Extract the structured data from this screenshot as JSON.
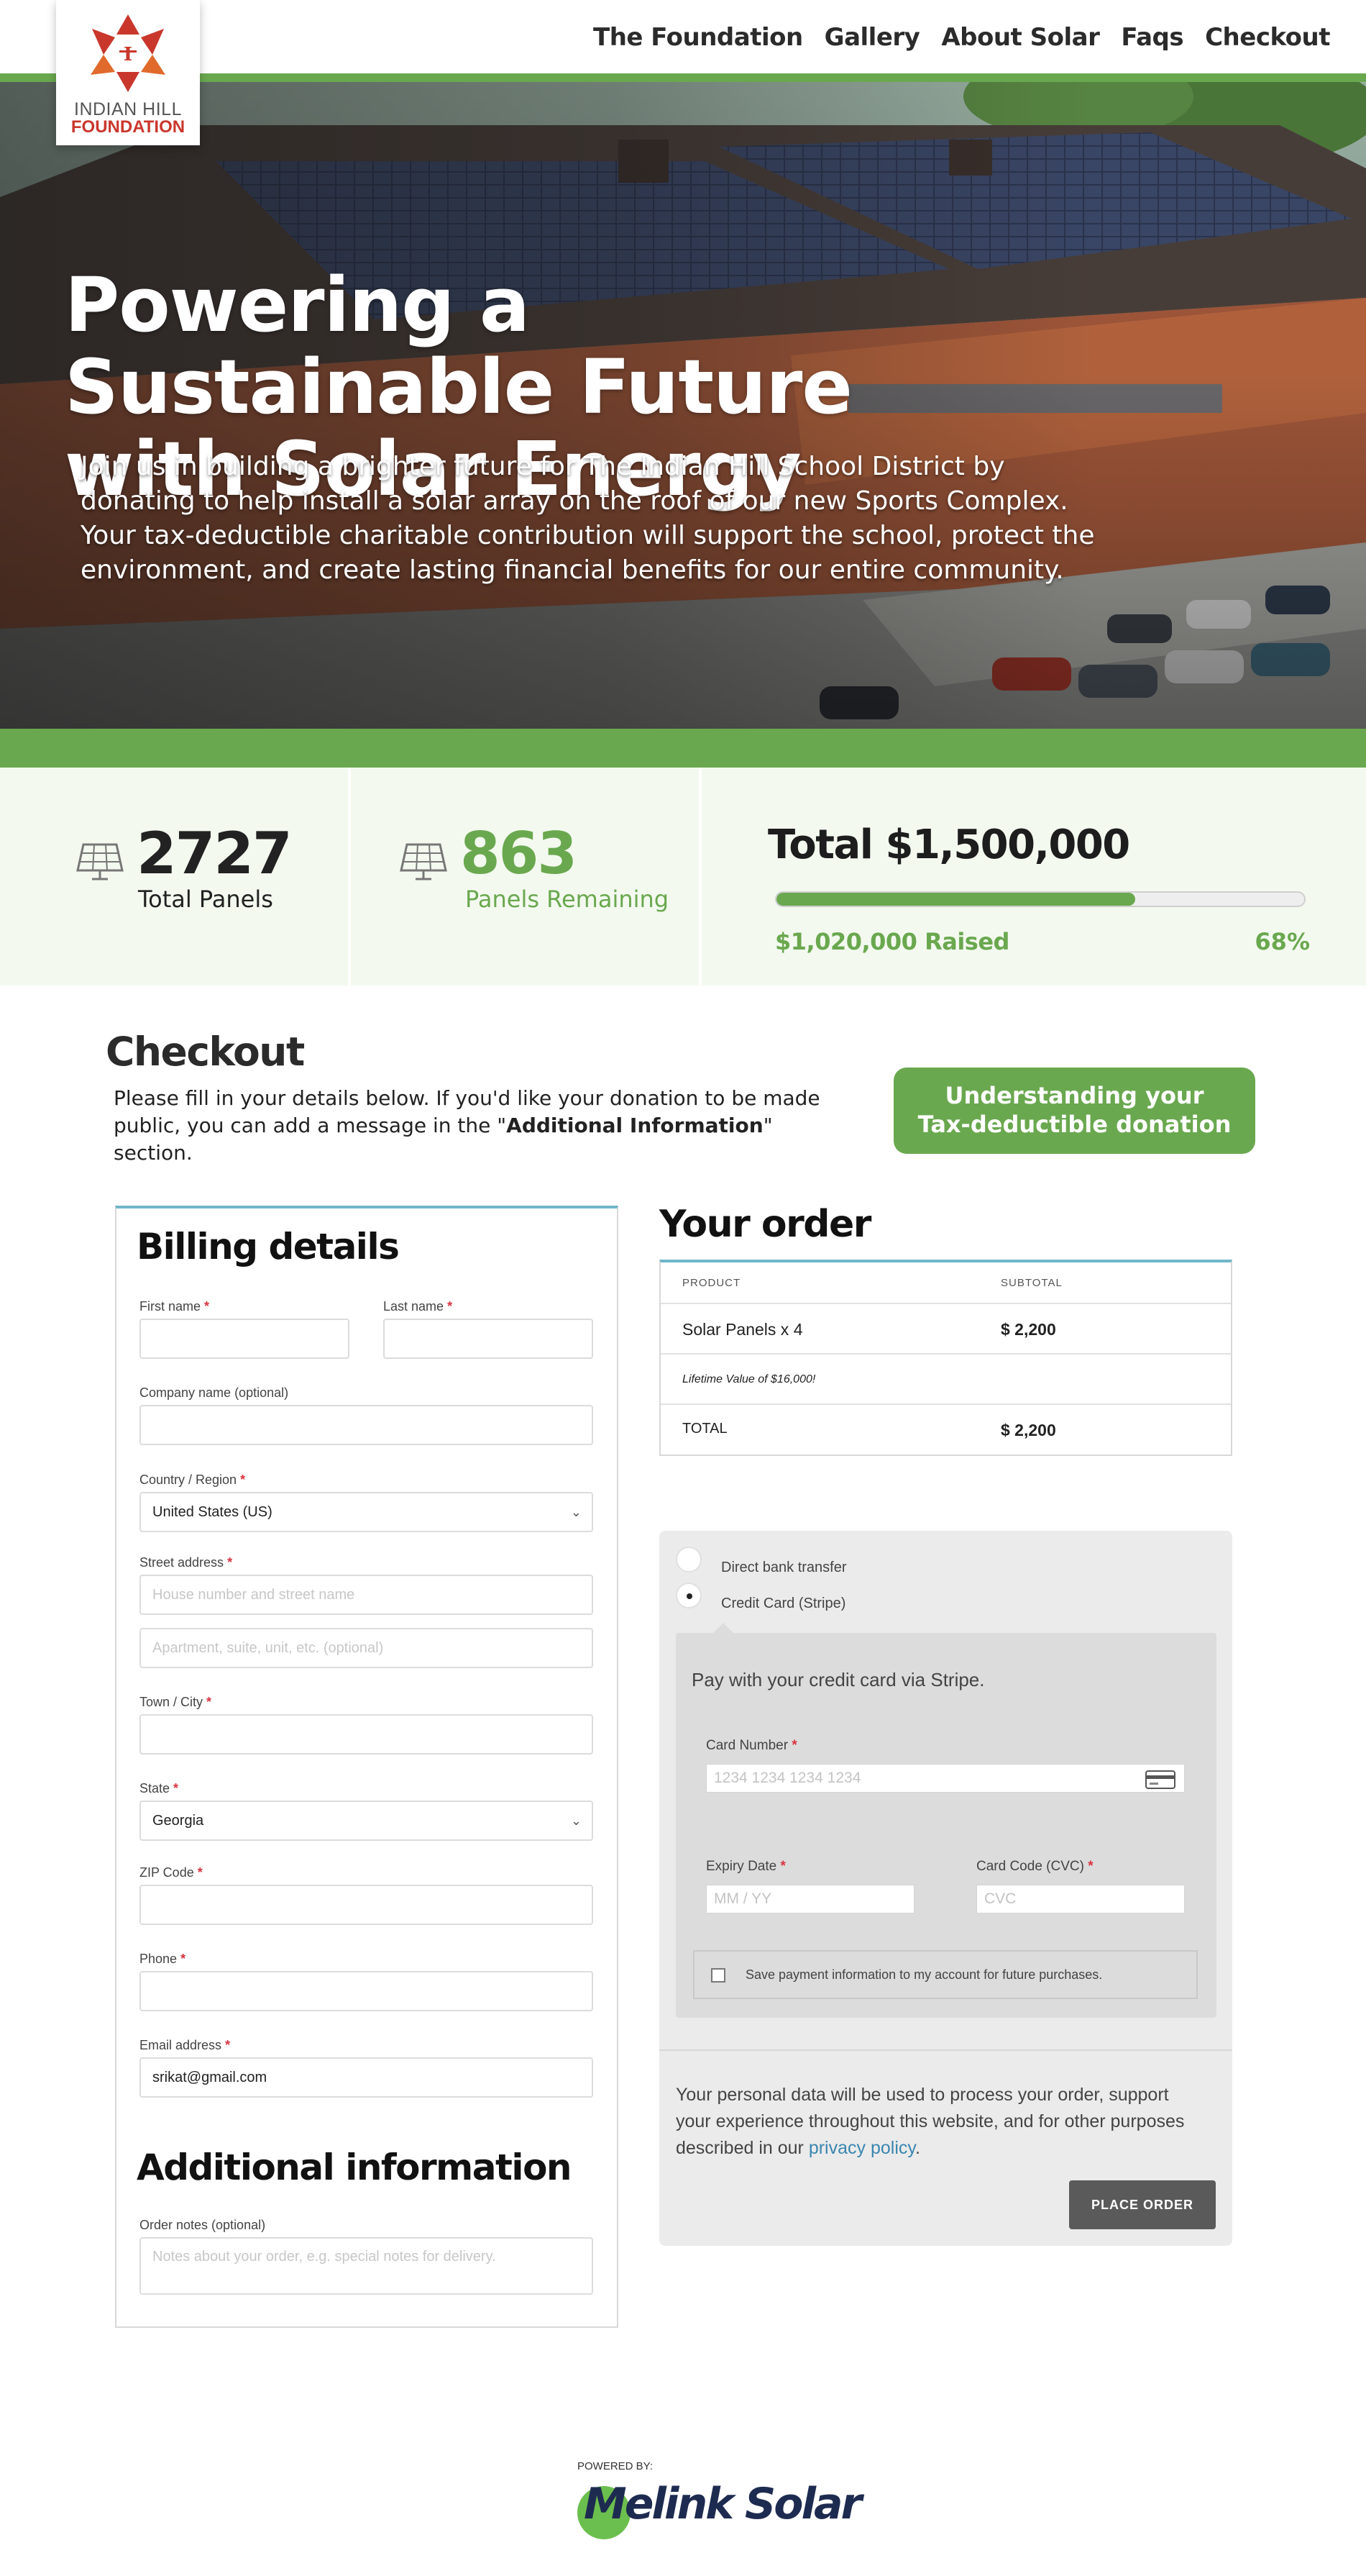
{
  "logo": {
    "line1": "INDIAN HILL",
    "line2": "FOUNDATION",
    "mark_colors": [
      "#c9372c",
      "#e87b2a"
    ]
  },
  "nav": {
    "items": [
      "The Foundation",
      "Gallery",
      "About Solar",
      "Faqs",
      "Checkout"
    ]
  },
  "hero": {
    "title_lines": [
      "Powering a",
      "Sustainable Future",
      "with Solar Energy"
    ],
    "text": "Join us in building a brighter future for The Indian Hill School District by donating to help install a solar array on the roof of our new Sports Complex. Your tax-deductible charitable contribution will support the school, protect the environment, and create lasting financial benefits for our entire community."
  },
  "stats": {
    "total_panels": {
      "value": "2727",
      "label": "Total Panels",
      "icon": "solar-panel-icon"
    },
    "remaining": {
      "value": "863",
      "label": "Panels Remaining",
      "icon": "solar-panel-icon"
    },
    "total": "Total $1,500,000",
    "raised": "$1,020,000 Raised",
    "percent": "68%",
    "progress_fraction": 0.68
  },
  "checkout": {
    "title": "Checkout",
    "intro_before": "Please fill in your details below. If you'd like your donation to be made public, you can add a message in the \"",
    "intro_bold": "Additional Information",
    "intro_after": "\" section.",
    "tax_button": [
      "Understanding your",
      "Tax-deductible donation"
    ]
  },
  "billing": {
    "title": "Billing details",
    "first_name": {
      "label": "First name",
      "value": ""
    },
    "last_name": {
      "label": "Last name",
      "value": ""
    },
    "company": {
      "label": "Company name (optional)",
      "value": ""
    },
    "country": {
      "label": "Country / Region",
      "value": "United States (US)"
    },
    "street": {
      "label": "Street address",
      "placeholder1": "House number and street name",
      "placeholder2": "Apartment, suite, unit, etc. (optional)"
    },
    "town": {
      "label": "Town / City",
      "value": ""
    },
    "state": {
      "label": "State",
      "value": "Georgia"
    },
    "zip": {
      "label": "ZIP Code",
      "value": ""
    },
    "phone": {
      "label": "Phone",
      "value": ""
    },
    "email": {
      "label": "Email address",
      "value": "srikat@gmail.com"
    },
    "required_mark": "*"
  },
  "additional": {
    "title": "Additional information",
    "notes_label": "Order notes (optional)",
    "notes_placeholder": "Notes about your order, e.g. special notes for delivery."
  },
  "order": {
    "title": "Your order",
    "col_product": "PRODUCT",
    "col_subtotal": "SUBTOTAL",
    "item": "Solar Panels x 4",
    "item_price": "$ 2,200",
    "lifetime": "Lifetime Value of $16,000!",
    "total_label": "TOTAL",
    "total_value": "$ 2,200"
  },
  "payment": {
    "option_bank": "Direct bank transfer",
    "option_card": "Credit Card (Stripe)",
    "selected": "Credit Card (Stripe)",
    "stripe_text": "Pay with your credit card via Stripe.",
    "card_number_label": "Card Number",
    "card_number_placeholder": "1234 1234 1234 1234",
    "expiry_label": "Expiry Date",
    "expiry_placeholder": "MM / YY",
    "cvc_label": "Card Code (CVC)",
    "cvc_placeholder": "CVC",
    "save_text": "Save payment information to my account for future purchases.",
    "privacy_text": "Your personal data will be used to process your order, support your experience throughout this website, and for other purposes described in our ",
    "privacy_link": "privacy policy",
    "privacy_end": ".",
    "place_order": "PLACE ORDER"
  },
  "footer": {
    "powered_by": "POWERED BY:",
    "brand": "Melink Solar"
  },
  "colors": {
    "brand_green": "#6aa84f",
    "accent_blue": "#6fb6c9",
    "link_blue": "#3a86b0",
    "required_red": "#d9343f"
  }
}
